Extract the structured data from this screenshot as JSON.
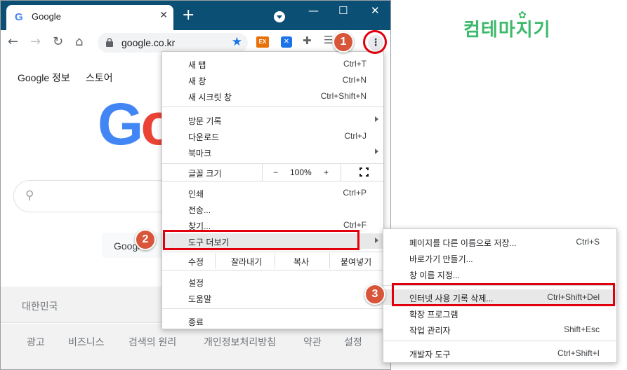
{
  "browser": {
    "tab_title": "Google",
    "tab_close": "✕",
    "new_tab": "+",
    "window_controls": {
      "minimize": "—",
      "maximize": "☐",
      "close": "✕"
    },
    "url": "google.co.kr",
    "extension_ex": "EX",
    "theme_color": "#0b4f74"
  },
  "page": {
    "top_links": [
      "Google 정보",
      "스토어"
    ],
    "search_button_label": "Google",
    "country": "대한민국",
    "footer_links": [
      "광고",
      "비즈니스",
      "검색의 원리",
      "개인정보처리방침",
      "약관",
      "설정"
    ]
  },
  "main_menu": {
    "new_tab": {
      "label": "새 탭",
      "shortcut": "Ctrl+T"
    },
    "new_window": {
      "label": "새 창",
      "shortcut": "Ctrl+N"
    },
    "new_incognito": {
      "label": "새 시크릿 창",
      "shortcut": "Ctrl+Shift+N"
    },
    "history": {
      "label": "방문 기록"
    },
    "downloads": {
      "label": "다운로드",
      "shortcut": "Ctrl+J"
    },
    "bookmarks": {
      "label": "북마크"
    },
    "zoom": {
      "label": "글꼴 크기",
      "minus": "−",
      "value": "100%",
      "plus": "+"
    },
    "print": {
      "label": "인쇄",
      "shortcut": "Ctrl+P"
    },
    "cast": {
      "label": "전송..."
    },
    "find": {
      "label": "찾기...",
      "shortcut": "Ctrl+F"
    },
    "more_tools": {
      "label": "도구 더보기"
    },
    "edit": {
      "label": "수정",
      "cut": "잘라내기",
      "copy": "복사",
      "paste": "붙여넣기"
    },
    "settings": {
      "label": "설정"
    },
    "help": {
      "label": "도움말"
    },
    "exit": {
      "label": "종료"
    }
  },
  "sub_menu": {
    "save_page": {
      "label": "페이지를 다른 이름으로 저장...",
      "shortcut": "Ctrl+S"
    },
    "create_shortcut": {
      "label": "바로가기 만들기..."
    },
    "name_window": {
      "label": "창 이름 지정..."
    },
    "clear_browsing": {
      "label": "인터넷 사용 기록 삭제...",
      "shortcut": "Ctrl+Shift+Del"
    },
    "extensions": {
      "label": "확장 프로그램"
    },
    "task_manager": {
      "label": "작업 관리자",
      "shortcut": "Shift+Esc"
    },
    "dev_tools": {
      "label": "개발자 도구",
      "shortcut": "Ctrl+Shift+I"
    }
  },
  "annotations": {
    "step1": "1",
    "step2": "2",
    "step3": "3",
    "highlight_color": "#e0000d",
    "badge_color": "#d9553a"
  },
  "watermark": "컴테마지기"
}
